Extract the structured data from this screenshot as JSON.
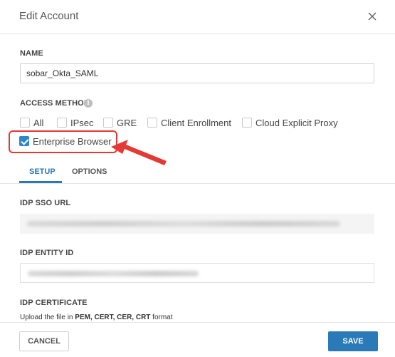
{
  "dialog": {
    "title": "Edit Account"
  },
  "name": {
    "label": "NAME",
    "value": "sobar_Okta_SAML"
  },
  "access_method": {
    "label": "ACCESS METHOD",
    "info_icon": "i",
    "options": [
      {
        "label": "All",
        "checked": false
      },
      {
        "label": "IPsec",
        "checked": false
      },
      {
        "label": "GRE",
        "checked": false
      },
      {
        "label": "Client Enrollment",
        "checked": false
      },
      {
        "label": "Cloud Explicit Proxy",
        "checked": false
      },
      {
        "label": "Enterprise Browser",
        "checked": true
      }
    ]
  },
  "tabs": [
    {
      "label": "SETUP",
      "active": true
    },
    {
      "label": "OPTIONS",
      "active": false
    }
  ],
  "setup": {
    "idp_sso_url_label": "IDP SSO URL",
    "idp_entity_id_label": "IDP ENTITY ID",
    "idp_certificate_label": "IDP CERTIFICATE",
    "upload_prefix": "Upload the file in ",
    "upload_formats": "PEM, CERT, CER, CRT",
    "upload_suffix": " format"
  },
  "footer": {
    "cancel_label": "CANCEL",
    "save_label": "SAVE"
  },
  "colors": {
    "accent": "#2a7ab8",
    "highlight": "#e53935"
  }
}
